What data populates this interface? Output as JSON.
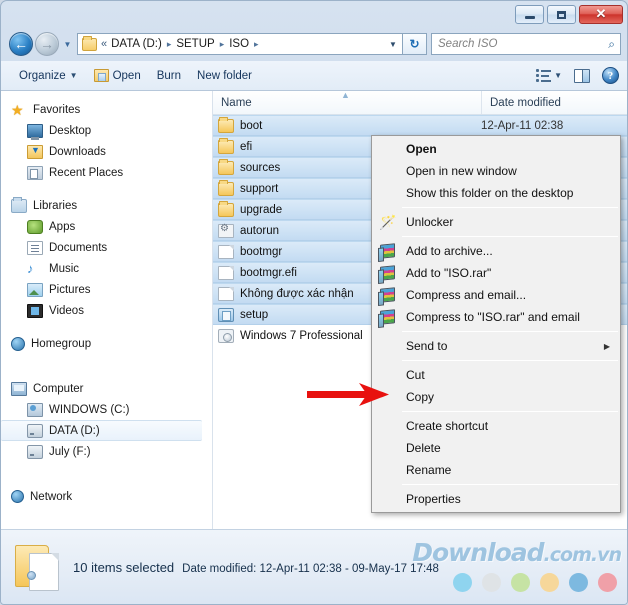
{
  "window": {
    "titlebar": {
      "minimize_label": "Minimize",
      "maximize_label": "Maximize",
      "close_label": "✕"
    }
  },
  "address_bar": {
    "back_glyph": "←",
    "forward_glyph": "→",
    "history_glyph": "▼",
    "separator": "▸",
    "overflow_glyph": "«",
    "crumbs": [
      "DATA (D:)",
      "SETUP",
      "ISO"
    ],
    "dropdown_glyph": "▼",
    "refresh_glyph": "↻"
  },
  "search": {
    "placeholder": "Search ISO",
    "value": "",
    "icon_glyph": "⌕"
  },
  "toolbar": {
    "organize_label": "Organize",
    "organize_caret": "▼",
    "open_label": "Open",
    "burn_label": "Burn",
    "new_folder_label": "New folder",
    "view_caret": "▼"
  },
  "sidebar": {
    "groups": [
      {
        "header": {
          "label": "Favorites",
          "icon": "star-icon"
        },
        "items": [
          {
            "label": "Desktop",
            "icon": "desktop-icon"
          },
          {
            "label": "Downloads",
            "icon": "downloads-icon"
          },
          {
            "label": "Recent Places",
            "icon": "recent-places-icon"
          }
        ]
      },
      {
        "header": {
          "label": "Libraries",
          "icon": "libraries-icon"
        },
        "items": [
          {
            "label": "Apps",
            "icon": "apps-icon"
          },
          {
            "label": "Documents",
            "icon": "documents-icon"
          },
          {
            "label": "Music",
            "icon": "music-icon"
          },
          {
            "label": "Pictures",
            "icon": "pictures-icon"
          },
          {
            "label": "Videos",
            "icon": "videos-icon"
          }
        ]
      },
      {
        "header": {
          "label": "Homegroup",
          "icon": "homegroup-icon"
        },
        "items": []
      },
      {
        "header": {
          "label": "Computer",
          "icon": "computer-icon"
        },
        "items": [
          {
            "label": "WINDOWS (C:)",
            "icon": "system-drive-icon",
            "selected": false
          },
          {
            "label": "DATA (D:)",
            "icon": "drive-icon",
            "selected": true
          },
          {
            "label": "July (F:)",
            "icon": "drive-icon",
            "selected": false
          }
        ]
      },
      {
        "header": {
          "label": "Network",
          "icon": "network-icon"
        },
        "items": []
      }
    ]
  },
  "file_list": {
    "columns": [
      {
        "label": "Name",
        "sorted": true,
        "sort_glyph": "▲"
      },
      {
        "label": "Date modified",
        "sorted": false
      }
    ],
    "rows": [
      {
        "name": "boot",
        "icon": "folder-icon",
        "selected": true,
        "date": "12-Apr-11 02:38"
      },
      {
        "name": "efi",
        "icon": "folder-icon",
        "selected": true,
        "date": ""
      },
      {
        "name": "sources",
        "icon": "folder-icon",
        "selected": true,
        "date": ""
      },
      {
        "name": "support",
        "icon": "folder-icon",
        "selected": true,
        "date": ""
      },
      {
        "name": "upgrade",
        "icon": "folder-icon",
        "selected": true,
        "date": ""
      },
      {
        "name": "autorun",
        "icon": "config-file-icon",
        "selected": true,
        "date": ""
      },
      {
        "name": "bootmgr",
        "icon": "file-icon",
        "selected": true,
        "date": ""
      },
      {
        "name": "bootmgr.efi",
        "icon": "file-icon",
        "selected": true,
        "date": ""
      },
      {
        "name": "Không được xác nhận",
        "icon": "file-icon",
        "selected": true,
        "date": ""
      },
      {
        "name": "setup",
        "icon": "setup-app-icon",
        "selected": true,
        "date": ""
      },
      {
        "name": "Windows 7 Professional",
        "icon": "iso-disc-icon",
        "selected": false,
        "date": ""
      }
    ]
  },
  "horizontal_scrollbar": {
    "left_glyph": "◀",
    "right_glyph": "▶",
    "grip_glyph": "|||"
  },
  "context_menu": {
    "items": [
      {
        "label": "Open",
        "bold": true,
        "icon": null,
        "separator_after": false,
        "submenu": false
      },
      {
        "label": "Open in new window",
        "bold": false,
        "icon": null,
        "separator_after": false,
        "submenu": false
      },
      {
        "label": "Show this folder on the desktop",
        "bold": false,
        "icon": null,
        "separator_after": true,
        "submenu": false
      },
      {
        "label": "Unlocker",
        "bold": false,
        "icon": "wand-icon",
        "separator_after": true,
        "submenu": false
      },
      {
        "label": "Add to archive...",
        "bold": false,
        "icon": "winrar-icon",
        "separator_after": false,
        "submenu": false
      },
      {
        "label": "Add to \"ISO.rar\"",
        "bold": false,
        "icon": "winrar-icon",
        "separator_after": false,
        "submenu": false
      },
      {
        "label": "Compress and email...",
        "bold": false,
        "icon": "winrar-icon",
        "separator_after": false,
        "submenu": false
      },
      {
        "label": "Compress to \"ISO.rar\" and email",
        "bold": false,
        "icon": "winrar-icon",
        "separator_after": true,
        "submenu": false
      },
      {
        "label": "Send to",
        "bold": false,
        "icon": null,
        "separator_after": true,
        "submenu": true
      },
      {
        "label": "Cut",
        "bold": false,
        "icon": null,
        "separator_after": false,
        "submenu": false
      },
      {
        "label": "Copy",
        "bold": false,
        "icon": null,
        "separator_after": true,
        "submenu": false
      },
      {
        "label": "Create shortcut",
        "bold": false,
        "icon": null,
        "separator_after": false,
        "submenu": false
      },
      {
        "label": "Delete",
        "bold": false,
        "icon": null,
        "separator_after": false,
        "submenu": false
      },
      {
        "label": "Rename",
        "bold": false,
        "icon": null,
        "separator_after": true,
        "submenu": false
      },
      {
        "label": "Properties",
        "bold": false,
        "icon": null,
        "separator_after": false,
        "submenu": false
      }
    ],
    "submenu_glyph": "▶"
  },
  "annotation": {
    "arrow_color": "#e8110f",
    "points_to": "Copy"
  },
  "status_bar": {
    "selection_text": "10 items selected",
    "date_modified_label": "Date modified:",
    "date_modified_value": "12-Apr-11 02:38 - 09-May-17 17:48"
  },
  "watermark": {
    "text_main": "Download",
    "text_tld": ".com.vn",
    "color": "#9ec4e0",
    "dots": [
      "#8fd4ef",
      "#dfe3e6",
      "#c6e3a4",
      "#f6d79a",
      "#7db9e0",
      "#f0a0a8"
    ]
  }
}
